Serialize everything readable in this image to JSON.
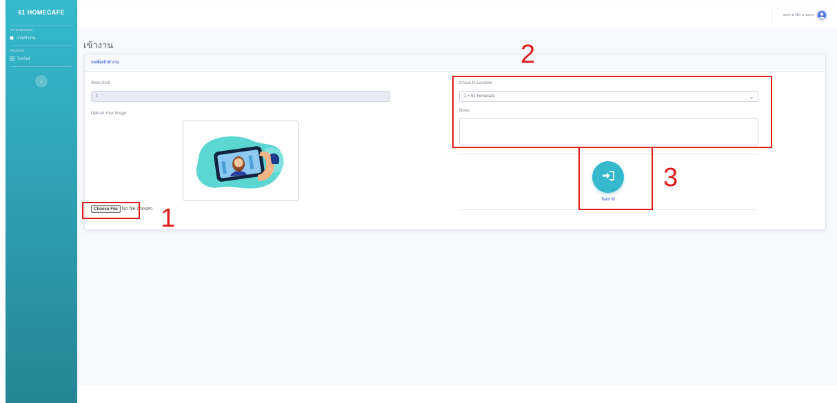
{
  "sidebar": {
    "brand": "61 HOMECAFE",
    "sections": [
      {
        "heading": "ATTENDANCE",
        "items": [
          {
            "label": "การเข้างาน",
            "icon": "calendar-icon"
          }
        ]
      },
      {
        "heading": "PROFILE",
        "items": [
          {
            "label": "โปรไฟล์",
            "icon": "grid-icon"
          }
        ]
      }
    ],
    "toggle_icon": "chevron-left-icon"
  },
  "topbar": {
    "user_name": "สมชาย เชื่อ นามสกุล",
    "avatar_icon": "user-avatar-icon"
  },
  "page": {
    "title": "เข้างาน"
  },
  "card": {
    "header": "กดเพื่อเข้าทำงาน",
    "work_shift": {
      "label": "Work Shift",
      "value": "1"
    },
    "upload": {
      "label": "Upload Your Image",
      "button": "Choose File",
      "status": "No file chosen",
      "image_icon": "selfie-phone-illustration"
    },
    "check_in_location": {
      "label": "Check In Location",
      "selected": "1 = 61 homecafe"
    },
    "notes": {
      "label": "Notes",
      "value": ""
    },
    "turn_button": {
      "icon": "sign-in-icon",
      "label": "Turn It!"
    }
  },
  "annotations": {
    "color": "#e01a1a",
    "markers": [
      "1",
      "2",
      "3"
    ]
  },
  "colors": {
    "sidebar_top": "#36b9cc",
    "sidebar_bottom": "#258595",
    "primary": "#4e73df",
    "info": "#36b9cc"
  }
}
